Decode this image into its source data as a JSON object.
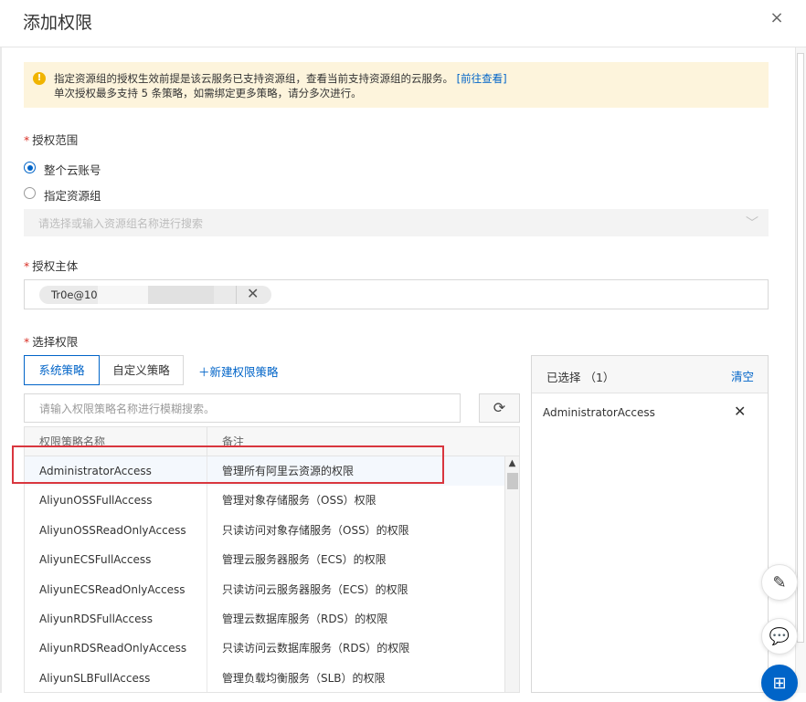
{
  "dialog": {
    "title": "添加权限",
    "close_icon": "×"
  },
  "notice": {
    "icon": "!",
    "line1_text": "指定资源组的授权生效前提是该云服务已支持资源组，查看当前支持资源组的云服务。",
    "line1_link": "[前往查看]",
    "line2_text": "单次授权最多支持 5 条策略，如需绑定更多策略，请分多次进行。"
  },
  "scope": {
    "required_mark": "*",
    "label": "授权范围",
    "options": [
      {
        "label": "整个云账号",
        "selected": true
      },
      {
        "label": "指定资源组",
        "selected": false
      }
    ],
    "resource_group_placeholder": "请选择或输入资源组名称进行搜索",
    "chevron": "﹀"
  },
  "principal": {
    "required_mark": "*",
    "label": "授权主体",
    "tag_text": "Tr0e@100",
    "remove_icon": "✕"
  },
  "permissions": {
    "required_mark": "*",
    "label": "选择权限",
    "tabs": [
      {
        "label": "系统策略",
        "active": true
      },
      {
        "label": "自定义策略",
        "active": false
      }
    ],
    "new_policy": "＋新建权限策略",
    "search_placeholder": "请输入权限策略名称进行模糊搜索。",
    "refresh_icon": "⟳",
    "columns": [
      "权限策略名称",
      "备注"
    ],
    "rows": [
      {
        "name": "AdministratorAccess",
        "note": "管理所有阿里云资源的权限"
      },
      {
        "name": "AliyunOSSFullAccess",
        "note": "管理对象存储服务（OSS）权限"
      },
      {
        "name": "AliyunOSSReadOnlyAccess",
        "note": "只读访问对象存储服务（OSS）的权限"
      },
      {
        "name": "AliyunECSFullAccess",
        "note": "管理云服务器服务（ECS）的权限"
      },
      {
        "name": "AliyunECSReadOnlyAccess",
        "note": "只读访问云服务器服务（ECS）的权限"
      },
      {
        "name": "AliyunRDSFullAccess",
        "note": "管理云数据库服务（RDS）的权限"
      },
      {
        "name": "AliyunRDSReadOnlyAccess",
        "note": "只读访问云数据库服务（RDS）的权限"
      },
      {
        "name": "AliyunSLBFullAccess",
        "note": "管理负载均衡服务（SLB）的权限"
      }
    ],
    "scroll_up_icon": "▲"
  },
  "selected_panel": {
    "title": "已选择 （1）",
    "clear_label": "清空",
    "items": [
      {
        "name": "AdministratorAccess"
      }
    ],
    "remove_icon": "✕"
  },
  "floating_buttons": {
    "edit_icon": "✎",
    "chat_icon": "💬",
    "apps_icon": "⊞"
  },
  "colors": {
    "accent": "#0064c8",
    "highlight_box": "#d9363e",
    "notice_bg": "#fdf4dc",
    "warning": "#f0b400"
  }
}
